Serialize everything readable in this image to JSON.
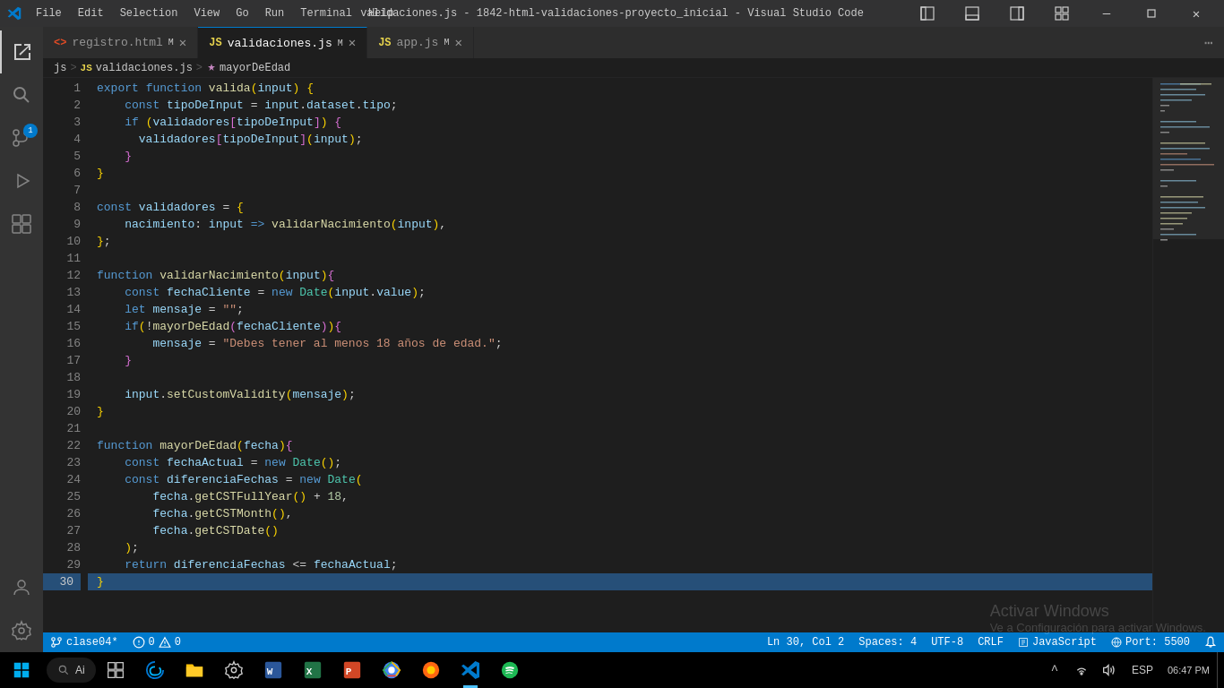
{
  "titleBar": {
    "title": "validaciones.js - 1842-html-validaciones-proyecto_inicial - Visual Studio Code",
    "menuItems": [
      "File",
      "Edit",
      "Selection",
      "View",
      "Go",
      "Run",
      "Terminal",
      "Help"
    ]
  },
  "tabs": [
    {
      "id": "registro",
      "icon": "html",
      "label": "registro.html",
      "modified": true,
      "active": false
    },
    {
      "id": "validaciones",
      "icon": "js",
      "label": "validaciones.js",
      "modified": true,
      "active": true
    },
    {
      "id": "app",
      "icon": "js",
      "label": "app.js",
      "modified": true,
      "active": false
    }
  ],
  "breadcrumb": {
    "parts": [
      "js",
      "JS validaciones.js",
      "mayorDeEdad"
    ]
  },
  "lines": [
    {
      "num": 1,
      "code": "export function valida(input) {"
    },
    {
      "num": 2,
      "code": "    const tipoDeInput = input.dataset.tipo;"
    },
    {
      "num": 3,
      "code": "    if (validadores[tipoDeInput]) {"
    },
    {
      "num": 4,
      "code": "      validadores[tipoDeInput](input);"
    },
    {
      "num": 5,
      "code": "    }"
    },
    {
      "num": 6,
      "code": "}"
    },
    {
      "num": 7,
      "code": ""
    },
    {
      "num": 8,
      "code": "const validadores = {"
    },
    {
      "num": 9,
      "code": "    nacimiento: input => validarNacimiento(input),"
    },
    {
      "num": 10,
      "code": "};"
    },
    {
      "num": 11,
      "code": ""
    },
    {
      "num": 12,
      "code": "function validarNacimiento(input){"
    },
    {
      "num": 13,
      "code": "    const fechaCliente = new Date(input.value);"
    },
    {
      "num": 14,
      "code": "    let mensaje = \"\";"
    },
    {
      "num": 15,
      "code": "    if(!mayorDeEdad(fechaCliente)){"
    },
    {
      "num": 16,
      "code": "        mensaje = \"Debes tener al menos 18 años de edad.\";"
    },
    {
      "num": 17,
      "code": "    }"
    },
    {
      "num": 18,
      "code": ""
    },
    {
      "num": 19,
      "code": "    input.setCustomValidity(mensaje);"
    },
    {
      "num": 20,
      "code": "}"
    },
    {
      "num": 21,
      "code": ""
    },
    {
      "num": 22,
      "code": "function mayorDeEdad(fecha){"
    },
    {
      "num": 23,
      "code": "    const fechaActual = new Date();"
    },
    {
      "num": 24,
      "code": "    const diferenciaFechas = new Date("
    },
    {
      "num": 25,
      "code": "        fecha.getCSTFullYear() + 18,"
    },
    {
      "num": 26,
      "code": "        fecha.getCSTMonth(),"
    },
    {
      "num": 27,
      "code": "        fecha.getCSTDate()"
    },
    {
      "num": 28,
      "code": "    );"
    },
    {
      "num": 29,
      "code": "    return diferenciaFechas <= fechaActual;"
    },
    {
      "num": 30,
      "code": "}"
    }
  ],
  "statusBar": {
    "branch": "clase04*",
    "errors": "0",
    "warnings": "0",
    "line": "Ln 30, Col 2",
    "spaces": "Spaces: 4",
    "encoding": "UTF-8",
    "lineEnding": "CRLF",
    "language": "JavaScript",
    "port": "Port: 5500",
    "lang": "ESP"
  },
  "activateWindows": {
    "title": "Activar Windows",
    "subtitle": "Ve a Configuración para activar Windows."
  },
  "taskbar": {
    "searchPlaceholder": "Ai",
    "time": "06:47 PM",
    "language": "ESP"
  },
  "activityBar": {
    "icons": [
      {
        "name": "explorer-icon",
        "symbol": "⎘",
        "active": true
      },
      {
        "name": "search-icon",
        "symbol": "🔍",
        "active": false
      },
      {
        "name": "source-control-icon",
        "symbol": "⎇",
        "active": false,
        "badge": "1"
      },
      {
        "name": "run-debug-icon",
        "symbol": "▷",
        "active": false
      },
      {
        "name": "extensions-icon",
        "symbol": "⊞",
        "active": false
      }
    ],
    "bottomIcons": [
      {
        "name": "account-icon",
        "symbol": "👤"
      },
      {
        "name": "settings-icon",
        "symbol": "⚙"
      }
    ]
  }
}
